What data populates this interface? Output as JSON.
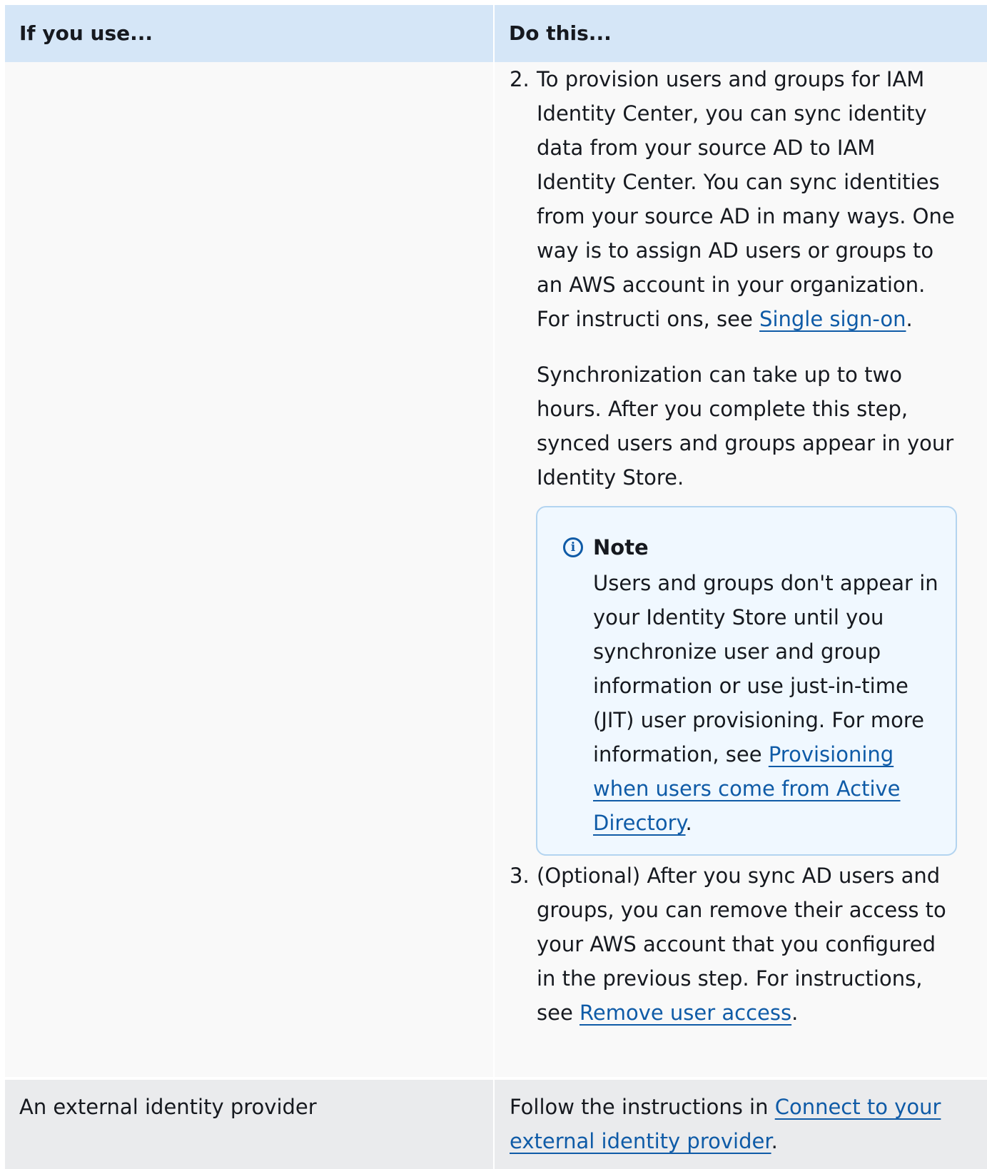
{
  "header": {
    "col1": "If you use...",
    "col2": "Do this..."
  },
  "row1": {
    "step2": {
      "number": "2.",
      "text": "To provision users and groups for IAM Identity Center, you can sync identity data from your source AD to IAM Identity Center. You can sync identities from your source AD in many ways. One way is to assign AD users or groups to an AWS account in your organization. For instructi ons, see ",
      "link": "Single sign-on",
      "after": ".",
      "para2": "Synchronization can take up to two hours. After you complete this step, synced users and groups appear in your Identity Store."
    },
    "note": {
      "icon": "info-icon",
      "title": "Note",
      "text": "Users and groups don't appear in your Identity Store until you synchronize user and group information or use just-in-time (JIT) user provisioning. For more information, see ",
      "link": "Provisioning when users come from Active Directory",
      "after": "."
    },
    "step3": {
      "number": "3.",
      "text": "(Optional) After you sync AD users and groups, you can remove their access to your AWS account that you configured in the previous step. For instructions, see ",
      "link": "Remove user access",
      "after": "."
    }
  },
  "row2": {
    "col1": "An external identity provider",
    "text": "Follow the instructions in ",
    "link": "Connect to your external identity provider",
    "after": "."
  }
}
